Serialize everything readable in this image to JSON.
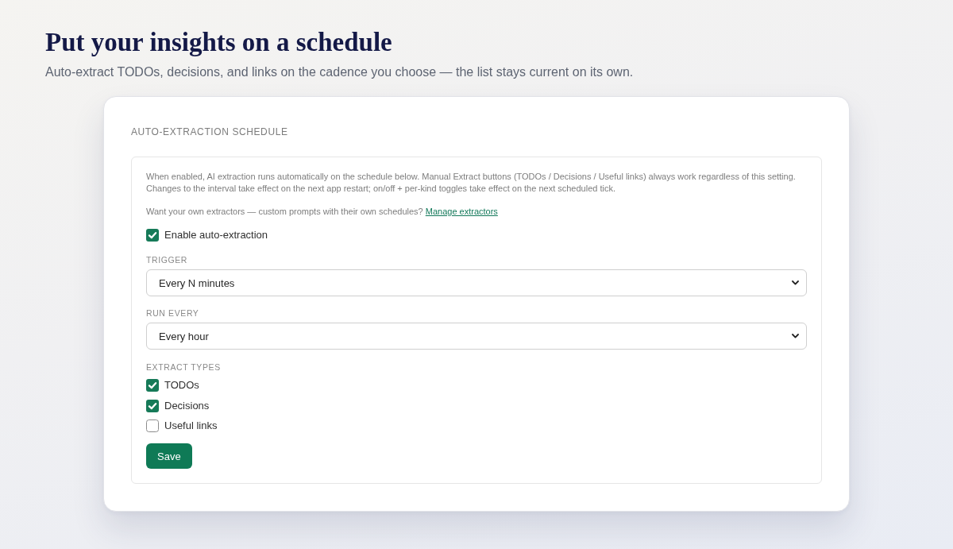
{
  "header": {
    "title": "Put your insights on a schedule",
    "subtitle": "Auto-extract TODOs, decisions, and links on the cadence you choose — the list stays current on its own."
  },
  "card": {
    "title": "AUTO-EXTRACTION SCHEDULE",
    "notice": {
      "lines": [
        "When enabled, AI extraction runs automatically on the schedule below. Manual Extract buttons (TODOs / Decisions / Useful links) always work regardless of this setting.",
        "Changes to the interval take effect on the next app restart; on/off + per-kind toggles take effect on the next scheduled tick."
      ]
    },
    "promo": {
      "text": "Want your own extractors — custom prompts with their own schedules?",
      "link": "Manage extractors"
    },
    "enable": {
      "label": "Enable auto-extraction",
      "checked": true
    },
    "fields": [
      {
        "label": "TRIGGER",
        "value": "Every N minutes"
      },
      {
        "label": "RUN EVERY",
        "value": "Every hour"
      }
    ],
    "extract_types": {
      "label": "EXTRACT TYPES",
      "options": [
        {
          "label": "TODOs",
          "checked": true
        },
        {
          "label": "Decisions",
          "checked": true
        },
        {
          "label": "Useful links",
          "checked": false
        }
      ]
    },
    "save_button": {
      "label": "Save"
    }
  }
}
